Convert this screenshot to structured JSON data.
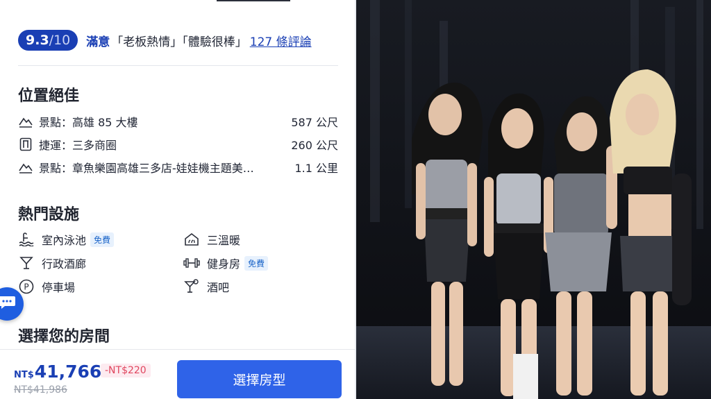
{
  "rating": {
    "score": "9.3",
    "denominator": "/10",
    "satisfaction": "滿意",
    "quotes": "「老板熱情」「體驗很棒」",
    "reviews": "127 條評論"
  },
  "location": {
    "title": "位置絕佳",
    "items": [
      {
        "icon": "attraction-mountain-icon",
        "label": "景點：高雄 85 大樓",
        "distance": "587 公尺"
      },
      {
        "icon": "metro-station-icon",
        "label": "捷運：三多商圈",
        "distance": "260 公尺"
      },
      {
        "icon": "attraction-mountain-icon",
        "label": "景點：章魚樂園高雄三多店-娃娃機主題美…",
        "distance": "1.1 公里"
      }
    ]
  },
  "facilities": {
    "title": "熱門設施",
    "free_label": "免費",
    "items": [
      {
        "icon": "swimming-pool-icon",
        "label": "室內泳池",
        "free": true
      },
      {
        "icon": "hot-spring-icon",
        "label": "三溫暖",
        "free": false
      },
      {
        "icon": "cocktail-glass-icon",
        "label": "行政酒廊",
        "free": false
      },
      {
        "icon": "dumbbell-icon",
        "label": "健身房",
        "free": true
      },
      {
        "icon": "parking-icon",
        "label": "停車場",
        "free": false
      },
      {
        "icon": "bar-drink-icon",
        "label": "酒吧",
        "free": false
      }
    ]
  },
  "rooms": {
    "title": "選擇您的房間"
  },
  "booking": {
    "currency": "NT$",
    "price": "41,766",
    "discount": "-NT$220",
    "old_price": "NT$41,986",
    "button_label": "選擇房型"
  },
  "colors": {
    "brand_blue": "#1a3fb4",
    "button_blue": "#2f63e8",
    "discount_red": "#e0465e"
  }
}
